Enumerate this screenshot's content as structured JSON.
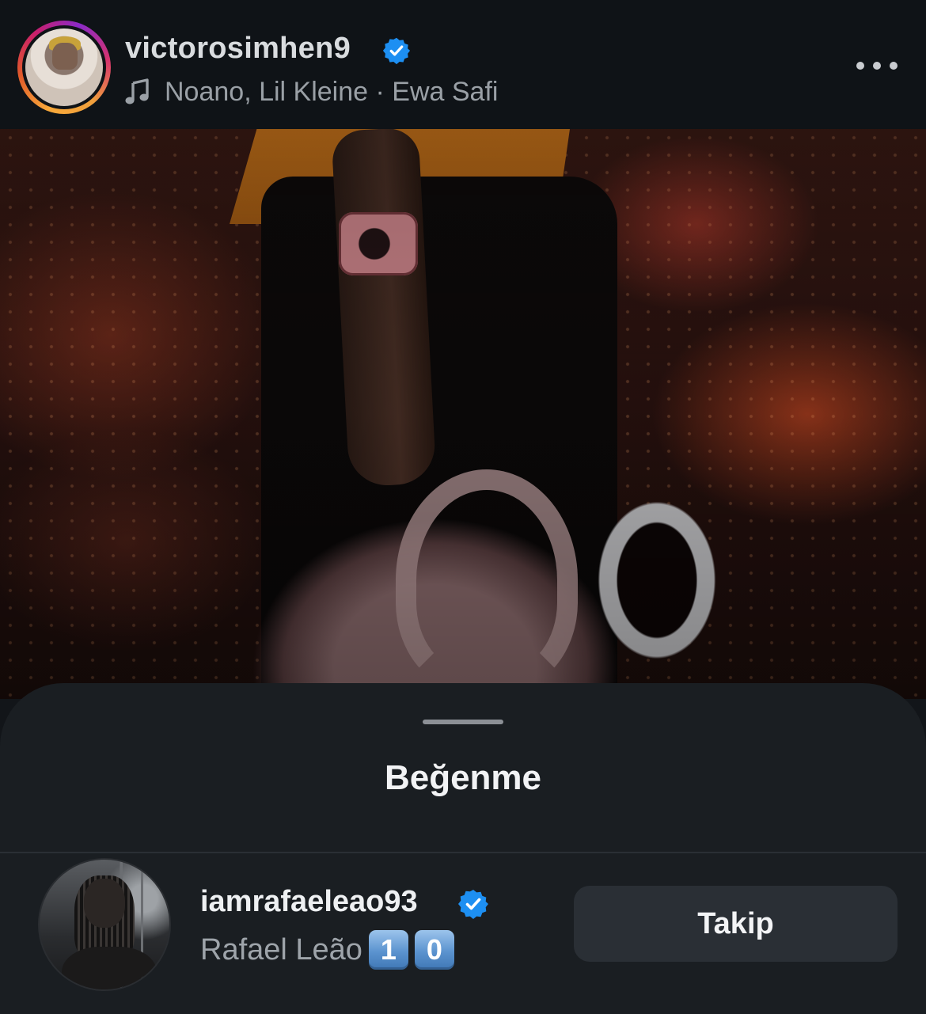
{
  "post": {
    "username": "victorosimhen9",
    "verified": true,
    "music": "Noano, Lil Kleine · Ewa Safi",
    "more_icon": "more-horizontal-icon"
  },
  "sheet": {
    "title": "Beğenme"
  },
  "liker": {
    "username": "iamrafaeleao93",
    "verified": true,
    "full_name": "Rafael Leão",
    "emoji_digits": [
      "1",
      "0"
    ],
    "follow_label": "Takip"
  },
  "colors": {
    "verified_blue": "#1d8ff2",
    "sheet_bg": "#1a1e22",
    "button_bg": "#2a2f35"
  }
}
